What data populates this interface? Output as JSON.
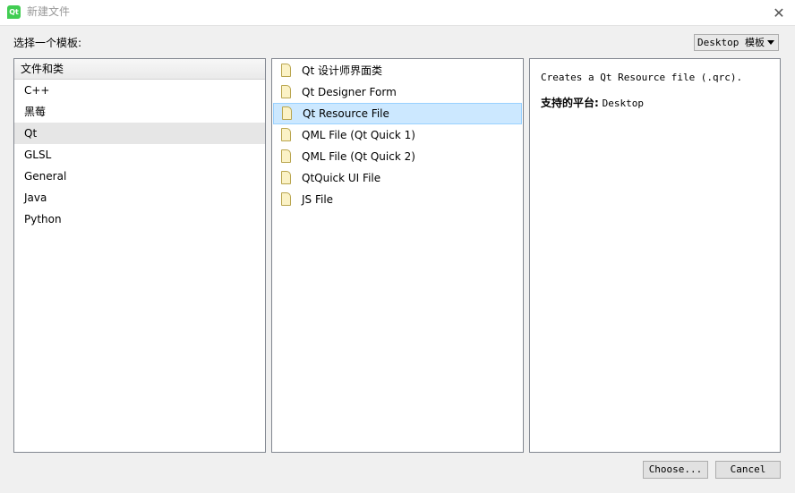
{
  "window": {
    "title": "新建文件",
    "app_icon_text": "Qt",
    "close_glyph": "✕"
  },
  "prompt": {
    "label": "选择一个模板:"
  },
  "platform_filter": {
    "selected": "Desktop 模板"
  },
  "categories": {
    "header": "文件和类",
    "items": [
      {
        "label": "C++"
      },
      {
        "label": "黑莓"
      },
      {
        "label": "Qt"
      },
      {
        "label": "GLSL"
      },
      {
        "label": "General"
      },
      {
        "label": "Java"
      },
      {
        "label": "Python"
      }
    ],
    "selected": "Qt"
  },
  "templates": {
    "items": [
      {
        "label": "Qt 设计师界面类",
        "icon": "file-icon"
      },
      {
        "label": "Qt Designer Form",
        "icon": "file-icon"
      },
      {
        "label": "Qt Resource File",
        "icon": "file-icon"
      },
      {
        "label": "QML File (Qt Quick 1)",
        "icon": "file-icon"
      },
      {
        "label": "QML File (Qt Quick 2)",
        "icon": "file-icon"
      },
      {
        "label": "QtQuick UI File",
        "icon": "file-icon"
      },
      {
        "label": "JS File",
        "icon": "file-icon"
      }
    ],
    "selected": "Qt Resource File"
  },
  "description": {
    "text": "Creates a Qt Resource file (.qrc).",
    "platforms_label": "支持的平台:",
    "platforms_value": "Desktop"
  },
  "buttons": {
    "choose": "Choose...",
    "cancel": "Cancel"
  },
  "colors": {
    "selection_blue": "#cce8ff",
    "category_selected": "#e6e6e6",
    "qt_green": "#41cd52"
  }
}
